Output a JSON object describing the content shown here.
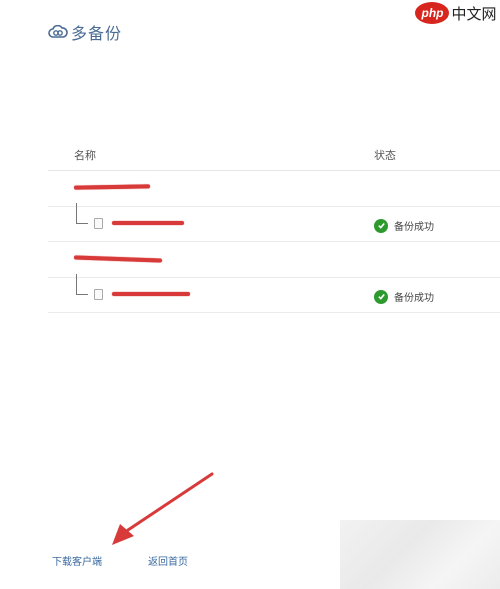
{
  "app": {
    "logo_text": "多备份"
  },
  "watermark": {
    "badge": "php",
    "text": "中文网"
  },
  "table": {
    "headers": {
      "name": "名称",
      "status": "状态"
    },
    "groups": [
      {
        "folder_name": "",
        "files": [
          {
            "name": "",
            "status": "备份成功"
          }
        ]
      },
      {
        "folder_name": "",
        "files": [
          {
            "name": "",
            "status": "备份成功"
          }
        ]
      }
    ]
  },
  "footer": {
    "download_client": "下载客户端",
    "back_home": "返回首页"
  },
  "colors": {
    "logo": "#4a6c93",
    "link": "#3b6aa0",
    "success": "#2e9a2e",
    "annotation": "#d83a3a",
    "watermark": "#d7261e"
  },
  "icons": {
    "logo": "cloud-link-icon",
    "file": "file-icon",
    "status": "check-circle-icon",
    "annotation": "arrow-icon"
  }
}
